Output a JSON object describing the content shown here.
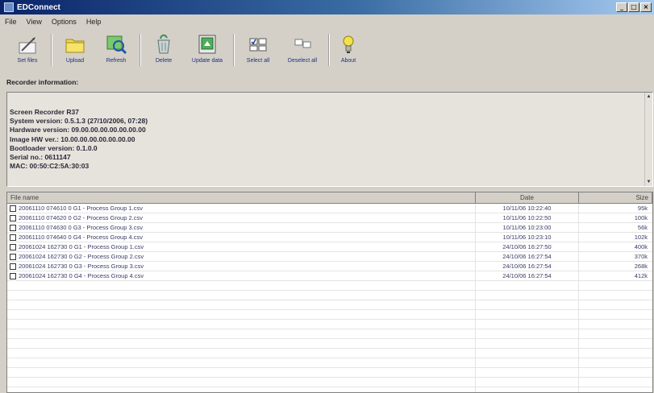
{
  "window": {
    "title": "EDConnect",
    "buttons": {
      "minimize": "_",
      "maximize": "□",
      "close": "×"
    }
  },
  "menu": [
    "File",
    "View",
    "Options",
    "Help"
  ],
  "toolbar": [
    {
      "label": "Set files",
      "icon": "pen-icon"
    },
    {
      "label": "Upload",
      "icon": "folder-icon"
    },
    {
      "label": "Refresh",
      "icon": "refresh-icon"
    },
    {
      "label": "Delete",
      "icon": "recycle-bin-icon"
    },
    {
      "label": "Update data",
      "icon": "update-data-icon"
    },
    {
      "label": "Select all",
      "icon": "select-all-icon"
    },
    {
      "label": "Deselect all",
      "icon": "deselect-all-icon"
    },
    {
      "label": "About",
      "icon": "lightbulb-icon"
    }
  ],
  "info_section": {
    "label": "Recorder information:",
    "lines": [
      "Screen Recorder R37",
      "System version: 0.5.1.3 (27/10/2006, 07:28)",
      "Hardware version: 09.00.00.00.00.00.00.00",
      "Image HW ver.: 10.00.00.00.00.00.00.00",
      "Bootloader version: 0.1.0.0",
      "Serial no.: 0611147",
      "MAC: 00:50:C2:5A:30:03"
    ]
  },
  "file_list": {
    "columns": [
      "File name",
      "Date",
      "Size"
    ],
    "rows": [
      {
        "name": "20061110 074610 0 G1 - Process Group 1.csv",
        "date": "10/11/06 10:22:40",
        "size": "95k"
      },
      {
        "name": "20061110 074620 0 G2 - Process Group 2.csv",
        "date": "10/11/06 10:22:50",
        "size": "100k"
      },
      {
        "name": "20061110 074630 0 G3 - Process Group 3.csv",
        "date": "10/11/06 10:23:00",
        "size": "56k"
      },
      {
        "name": "20061110 074640 0 G4 - Process Group 4.csv",
        "date": "10/11/06 10:23:10",
        "size": "102k"
      },
      {
        "name": "20061024 162730 0 G1 - Process Group 1.csv",
        "date": "24/10/06 16:27:50",
        "size": "400k"
      },
      {
        "name": "20061024 162730 0 G2 - Process Group 2.csv",
        "date": "24/10/06 16:27:54",
        "size": "370k"
      },
      {
        "name": "20061024 162730 0 G3 - Process Group 3.csv",
        "date": "24/10/06 16:27:54",
        "size": "268k"
      },
      {
        "name": "20061024 162730 0 G4 - Process Group 4.csv",
        "date": "24/10/06 16:27:54",
        "size": "412k"
      }
    ],
    "empty_rows": 12
  },
  "colors": {
    "title_start": "#0a246a",
    "title_end": "#a6caf0",
    "face": "#d4d0c8",
    "toolbar_text": "#1a2f7a"
  }
}
